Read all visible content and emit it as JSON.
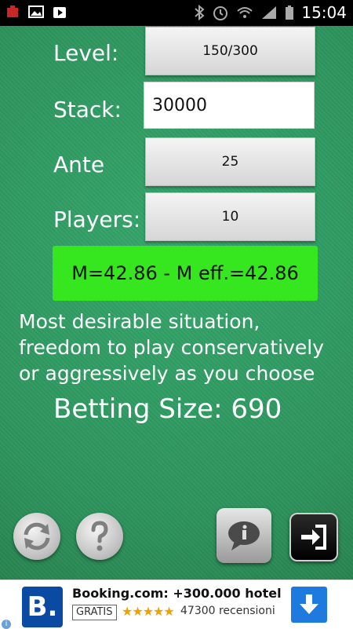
{
  "status_bar": {
    "time": "15:04"
  },
  "form": {
    "level_label": "Level:",
    "level_value": "150/300",
    "stack_label": "Stack:",
    "stack_value": "30000",
    "ante_label": "Ante",
    "ante_value": "25",
    "players_label": "Players:",
    "players_value": "10"
  },
  "result": {
    "m_text": "M=42.86 - M eff.=42.86",
    "description": "Most desirable situation, freedom to play conservatively or aggressively as you choose",
    "betting_size": "Betting Size: 690"
  },
  "toolbar": {
    "refresh_icon": "refresh-icon",
    "help_icon": "question-icon",
    "info_icon": "info-icon",
    "exit_icon": "exit-icon"
  },
  "ad": {
    "logo_letter": "B.",
    "title": "Booking.com: +300.000 hotel",
    "badge": "GRATIS",
    "stars": "★★★★★",
    "rating": 4.5,
    "reviews": "47300 recensioni"
  },
  "colors": {
    "felt_green": "#2f9a62",
    "result_green": "#36e61e",
    "ad_blue": "#1f7ae0",
    "booking_blue": "#0b4aa2"
  }
}
